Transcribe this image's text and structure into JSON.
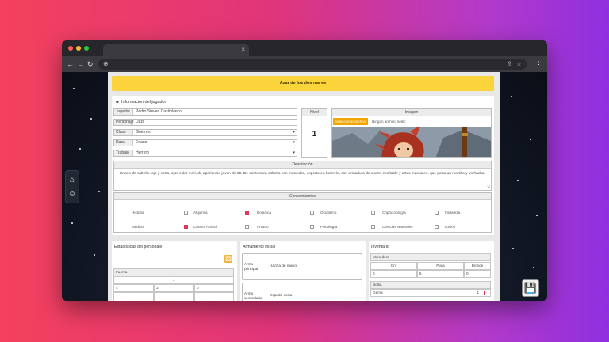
{
  "browser": {
    "tab_close": "×",
    "nav_back": "←",
    "nav_forward": "→",
    "nav_reload": "↻",
    "url_icon": "⊕",
    "share_icon": "⇪",
    "star_icon": "☆",
    "menu_icon": "⋮"
  },
  "banner": {
    "title": "Azar de los dos mares"
  },
  "player_info": {
    "heading": "Informacion del jugador",
    "fields": [
      {
        "label": "Jugador",
        "value": "Pedro Steven Castiblanco"
      },
      {
        "label": "Personaje",
        "value": "Dazi"
      },
      {
        "label": "Clase",
        "value": "Guerrero"
      },
      {
        "label": "Raza",
        "value": "Enano"
      },
      {
        "label": "Trabajo",
        "value": "Herrero"
      }
    ],
    "level": {
      "label": "Nivel",
      "value": "1"
    },
    "image": {
      "label": "Imagen",
      "button": "Seleccionar archivo",
      "file_text": "Ningún archivo selec"
    }
  },
  "description": {
    "label": "Descripción",
    "text": "Enano de cabello rojo y corto, ojos color miel, de apariencia joven de 30. De contextura esbelta con músculos, experto en herrería, con armadura de cuero, confiable y artes marciales, que porta un martillo y un hacha."
  },
  "knowledge": {
    "label": "Conocimientos",
    "items": [
      {
        "name": "Historia",
        "checked": false
      },
      {
        "name": "Alquimia",
        "checked": true
      },
      {
        "name": "Botánica",
        "checked": false
      },
      {
        "name": "Ocultismo",
        "checked": false
      },
      {
        "name": "Criptozoología",
        "checked": false
      },
      {
        "name": "Fortaleza",
        "checked": true
      },
      {
        "name": "Medium",
        "checked": false
      },
      {
        "name": "Control Animal",
        "checked": false
      },
      {
        "name": "Arcano",
        "checked": false
      },
      {
        "name": "Psicología",
        "checked": false
      },
      {
        "name": "Ciencias Naturales",
        "checked": false
      },
      {
        "name": "Ilusión",
        "checked": false
      }
    ]
  },
  "stats": {
    "title": "Estadisticas del personaje",
    "dice_icon": "⚄",
    "attribute": "Fuerza",
    "total": "7",
    "values": [
      "4",
      "3",
      "0"
    ]
  },
  "armament": {
    "title": "Armamento inicial",
    "rows": [
      {
        "label": "Arma principal",
        "value": "Hacha de mano"
      },
      {
        "label": "Arma secundaria",
        "value": "Espada corta"
      }
    ]
  },
  "inventory": {
    "title": "Inventario",
    "coins_label": "Monedero",
    "coins": [
      {
        "name": "Oro",
        "value": "0"
      },
      {
        "name": "Plata",
        "value": "5"
      },
      {
        "name": "Bronce",
        "value": "0"
      }
    ],
    "bag_label": "Bolsa",
    "bag_item": "Gema",
    "bag_qty": "1"
  },
  "sidenav": {
    "home_icon": "⌂",
    "user_icon": "☺"
  },
  "save_icon": "💾"
}
